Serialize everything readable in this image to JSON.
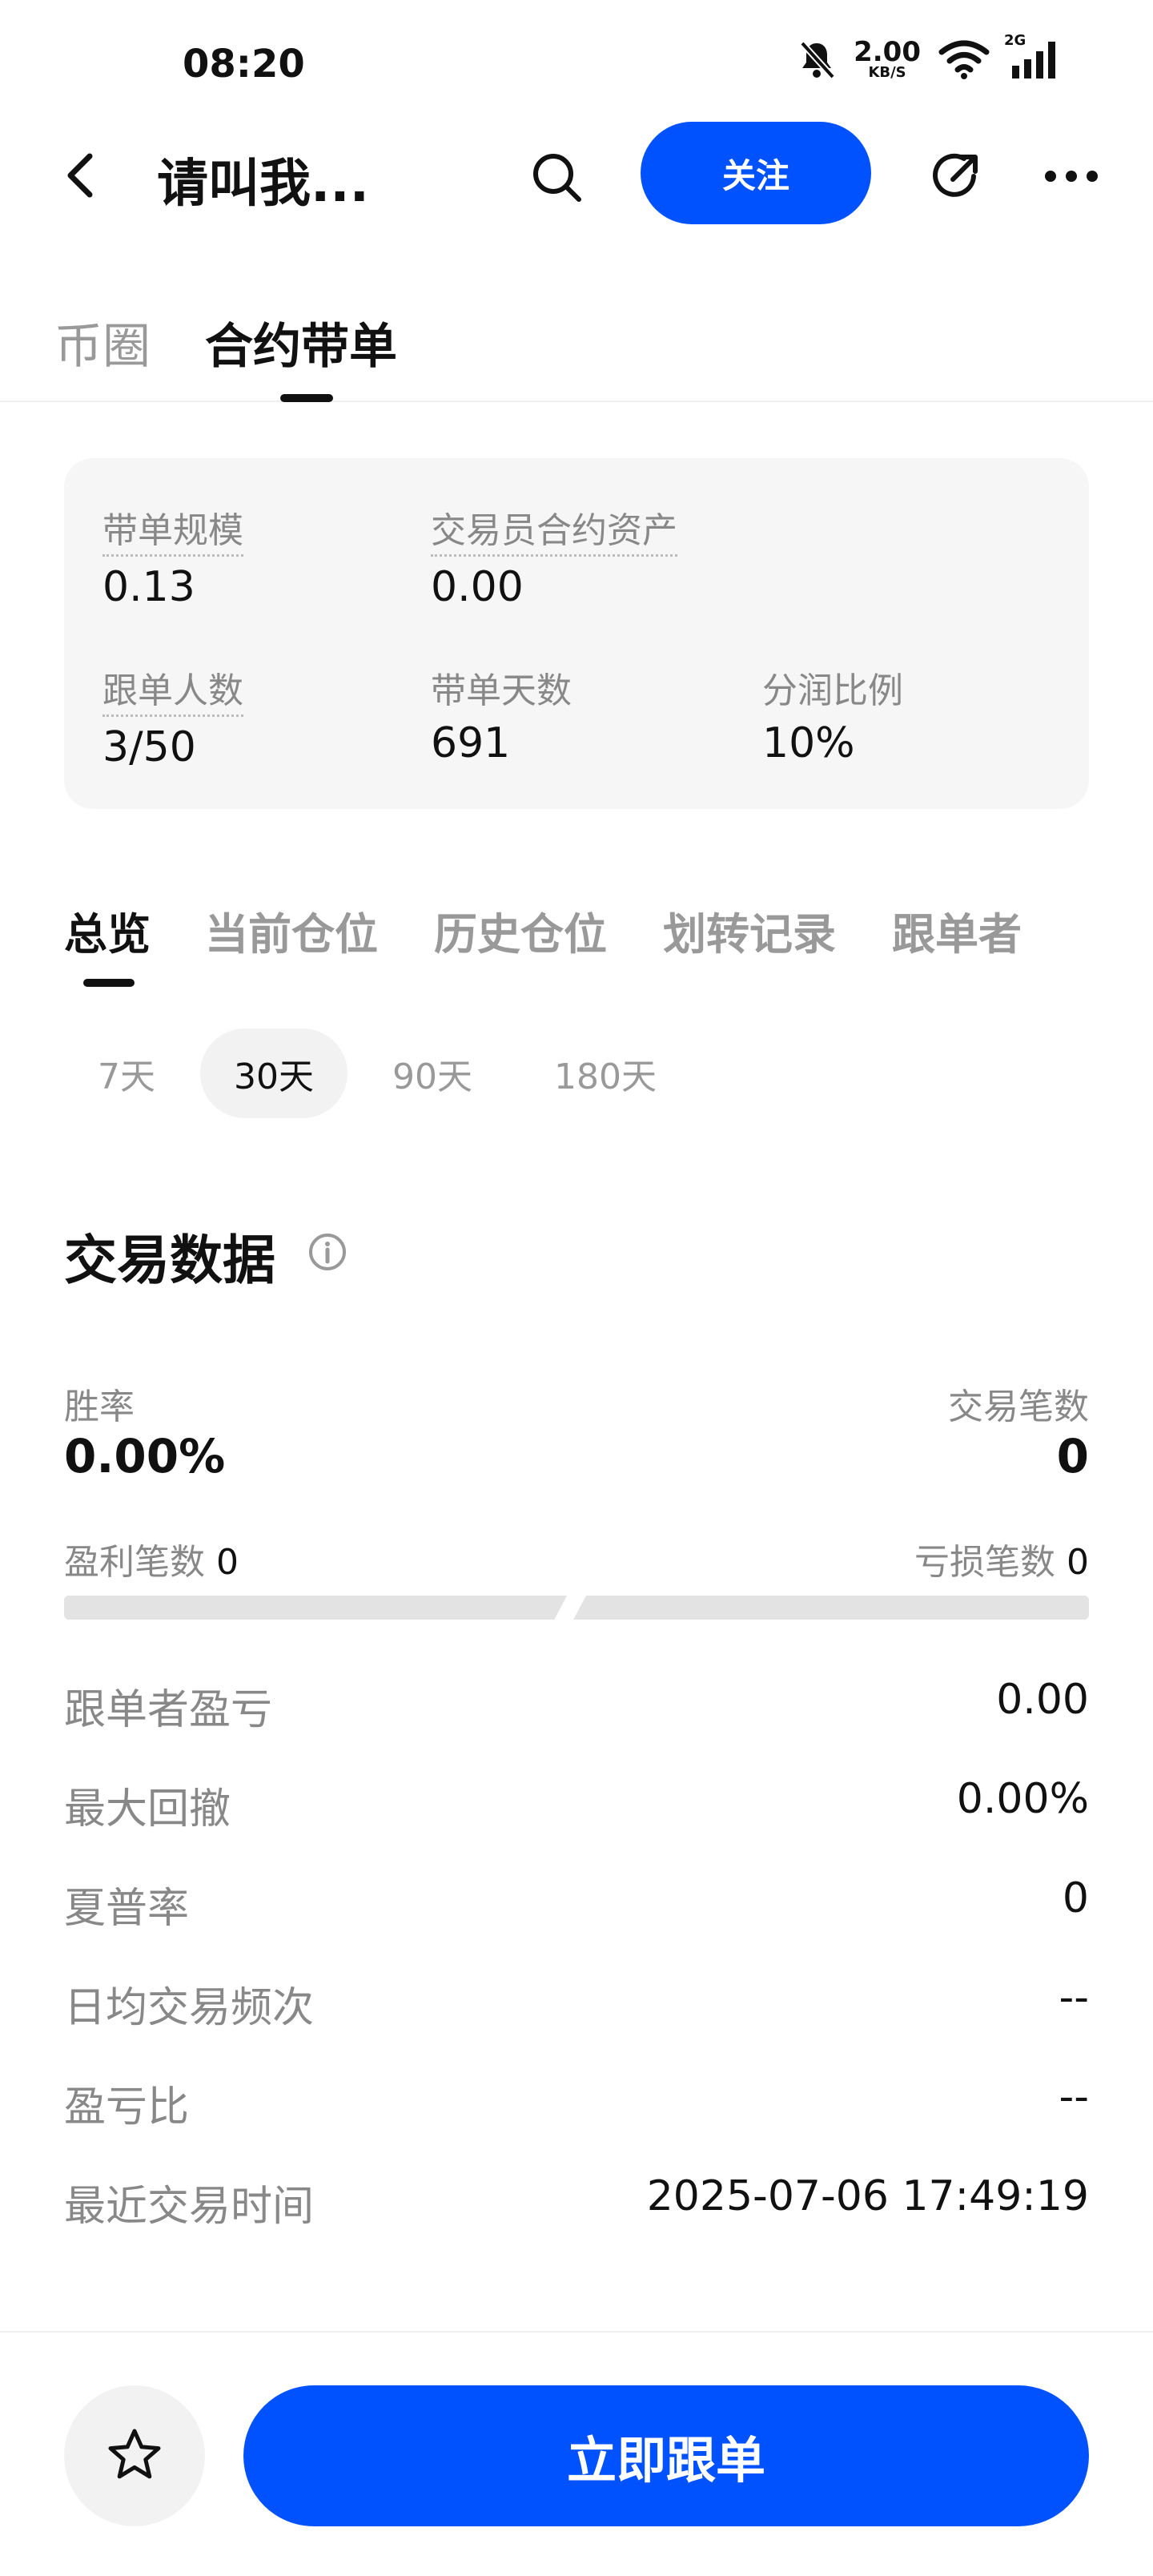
{
  "status_bar": {
    "time": "08:20",
    "net_speed_value": "2.00",
    "net_speed_unit": "KB/S",
    "signal_label": "2G",
    "icons": [
      "bell-muted-icon",
      "wifi-icon",
      "signal-icon"
    ]
  },
  "header": {
    "title": "请叫我...",
    "follow_label": "关注",
    "icons": [
      "back-icon",
      "search-icon",
      "share-icon",
      "more-icon"
    ]
  },
  "top_tabs": [
    {
      "label": "币圈",
      "active": false
    },
    {
      "label": "合约带单",
      "active": true
    }
  ],
  "stats": {
    "scale_label": "带单规模",
    "scale_value": "0.13",
    "assets_label": "交易员合约资产",
    "assets_value": "0.00",
    "followers_label": "跟单人数",
    "followers_value": "3/50",
    "days_label": "带单天数",
    "days_value": "691",
    "share_label": "分润比例",
    "share_value": "10%"
  },
  "sub_tabs": [
    {
      "label": "总览",
      "active": true
    },
    {
      "label": "当前仓位",
      "active": false
    },
    {
      "label": "历史仓位",
      "active": false
    },
    {
      "label": "划转记录",
      "active": false
    },
    {
      "label": "跟单者",
      "active": false
    }
  ],
  "periods": [
    {
      "label": "7天",
      "active": false
    },
    {
      "label": "30天",
      "active": true
    },
    {
      "label": "90天",
      "active": false
    },
    {
      "label": "180天",
      "active": false
    }
  ],
  "trade_data": {
    "title": "交易数据",
    "win_rate_label": "胜率",
    "win_rate_value": "0.00%",
    "trade_count_label": "交易笔数",
    "trade_count_value": "0",
    "profit_count_label": "盈利笔数",
    "profit_count_value": "0",
    "loss_count_label": "亏损笔数",
    "loss_count_value": "0",
    "rows": [
      {
        "label": "跟单者盈亏",
        "value": "0.00"
      },
      {
        "label": "最大回撤",
        "value": "0.00%"
      },
      {
        "label": "夏普率",
        "value": "0"
      },
      {
        "label": "日均交易频次",
        "value": "--"
      },
      {
        "label": "盈亏比",
        "value": "--"
      },
      {
        "label": "最近交易时间",
        "value": "2025-07-06 17:49:19"
      }
    ]
  },
  "bottom": {
    "copy_label": "立即跟单",
    "favorite_icon": "star-icon"
  },
  "colors": {
    "accent": "#0052ff",
    "text_primary": "#111111",
    "text_secondary": "#888888",
    "card_bg": "#f6f6f6"
  }
}
